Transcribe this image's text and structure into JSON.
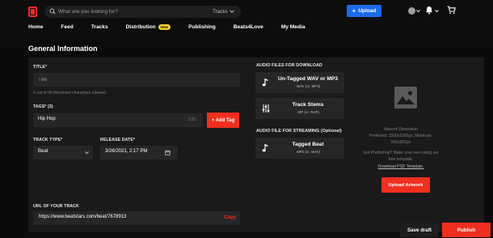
{
  "header": {
    "search_placeholder": "What are you looking for?",
    "search_scope": "Tracks",
    "upload_label": "Upload"
  },
  "nav": {
    "items": [
      "Home",
      "Feed",
      "Tracks",
      "Distribution",
      "Publishing",
      "Beats4Love",
      "My Media"
    ],
    "badge": "New"
  },
  "page": {
    "title": "General Information"
  },
  "form": {
    "title_label": "TITLE*",
    "title_placeholder": "Title",
    "title_hint": "0 out of 90 Maximum characters allowed",
    "tags_label": "TAGS* (3)",
    "tags_value": "Hip Hop",
    "tags_counter": "7/25",
    "add_tag_label": "+ Add Tag",
    "track_type_label": "TRACK TYPE*",
    "track_type_value": "Beat",
    "release_date_label": "RELEASE DATE*",
    "release_date_value": "3/26/2021, 2:17 PM",
    "url_label": "URL OF YOUR TRACK",
    "url_value": "https://www.beatstars.com/beat/7678913",
    "copy_label": "Copy"
  },
  "files": {
    "download_heading": "AUDIO FILES FOR DOWNLOAD",
    "streaming_heading": "AUDIO FILE FOR STREAMING (Optional)",
    "cards": [
      {
        "title": "Un-Tagged WAV or MP3",
        "sub": ".WAV (or .MP3)",
        "icon": "music-note-icon"
      },
      {
        "title": "Track Stems",
        "sub": ".ZIP (or .RAR)",
        "icon": "stems-sliders-icon"
      },
      {
        "title": "Tagged Beat",
        "sub": ".MP3 (or .WAV)",
        "icon": "music-note-icon"
      }
    ]
  },
  "artwork": {
    "heading": "Artwork Dimension",
    "line1": "Preferred: 1500x1500px, Minimum:",
    "line2": "500x500px",
    "line3": "Got Photoshop? Make your own using our",
    "line4": "free template.",
    "link": "Download PSD Template.",
    "button": "Upload Artwork"
  },
  "footer": {
    "save_draft": "Save draft",
    "publish": "Publish"
  },
  "colors": {
    "accent_red": "#ef2f1f",
    "accent_blue": "#1a6be8",
    "badge_yellow": "#f3d22d",
    "background": "#0b0b0c",
    "panel": "#1a1a1b",
    "field": "#262628"
  }
}
